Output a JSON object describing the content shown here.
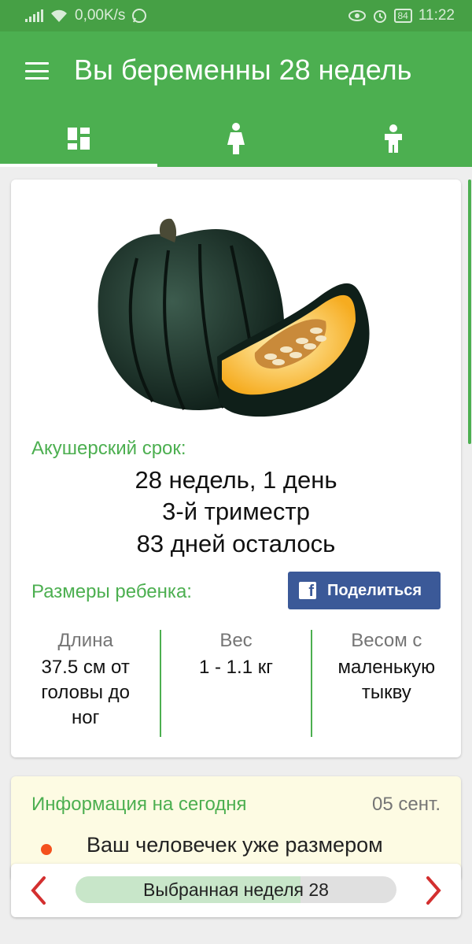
{
  "status": {
    "speed": "0,00K/s",
    "battery": "84",
    "time": "11:22"
  },
  "header": {
    "title": "Вы беременны 28 недель",
    "tabs": [
      {
        "icon": "dashboard-icon",
        "active": true
      },
      {
        "icon": "pregnant-woman-icon",
        "active": false
      },
      {
        "icon": "child-icon",
        "active": false
      }
    ]
  },
  "fruit": {
    "icon": "acorn-squash-icon"
  },
  "term": {
    "label": "Акушерский срок:",
    "line1": "28 недель, 1 день",
    "line2": "3-й триместр",
    "line3": "83 дней осталось"
  },
  "sizes": {
    "label": "Размеры ребенка:",
    "share_label": "Поделиться",
    "length_label": "Длина",
    "length_value": "37.5 см от головы до ног",
    "weight_label": "Вес",
    "weight_value": "1 - 1.1 кг",
    "compare_label": "Весом с",
    "compare_value": "маленькую тыкву"
  },
  "info": {
    "title": "Информация на сегодня",
    "date": "05 сент.",
    "text": "Ваш человечек уже размером"
  },
  "week_selector": {
    "label": "Выбранная неделя 28",
    "progress_fraction": 0.7
  },
  "colors": {
    "primary": "#4caf50",
    "statusbar": "#46a045",
    "facebook": "#3b5998",
    "bullet": "#f4511e"
  }
}
